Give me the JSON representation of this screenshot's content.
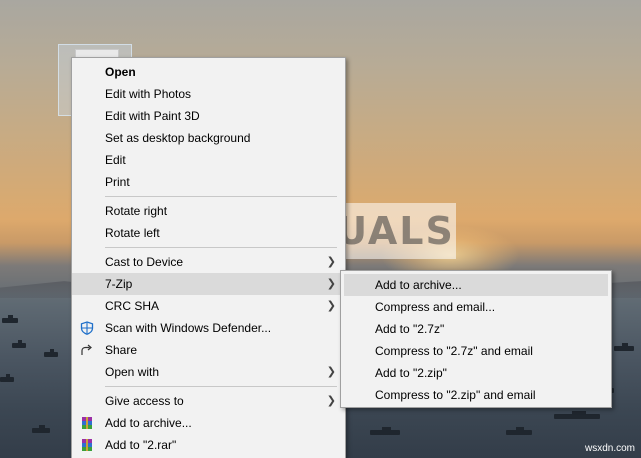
{
  "desktop": {
    "watermark": "APPUALS",
    "site": "wsxdn.com"
  },
  "context_menu": {
    "items": [
      {
        "label": "Open",
        "bold": true
      },
      {
        "label": "Edit with Photos"
      },
      {
        "label": "Edit with Paint 3D"
      },
      {
        "label": "Set as desktop background"
      },
      {
        "label": "Edit"
      },
      {
        "label": "Print"
      },
      {
        "label": "Rotate right"
      },
      {
        "label": "Rotate left"
      },
      {
        "label": "Cast to Device",
        "submenu": true
      },
      {
        "label": "7-Zip",
        "submenu": true,
        "highlighted": true
      },
      {
        "label": "CRC SHA",
        "submenu": true
      },
      {
        "label": "Scan with Windows Defender...",
        "icon": "windows-defender-icon"
      },
      {
        "label": "Share",
        "icon": "share-icon"
      },
      {
        "label": "Open with",
        "submenu": true
      },
      {
        "label": "Give access to",
        "submenu": true
      },
      {
        "label": "Add to archive...",
        "icon": "winrar-icon"
      },
      {
        "label": "Add to \"2.rar\"",
        "icon": "winrar-icon"
      }
    ]
  },
  "submenu_7zip": {
    "items": [
      {
        "label": "Add to archive...",
        "highlighted": true
      },
      {
        "label": "Compress and email..."
      },
      {
        "label": "Add to \"2.7z\""
      },
      {
        "label": "Compress to \"2.7z\" and email"
      },
      {
        "label": "Add to \"2.zip\""
      },
      {
        "label": "Compress to \"2.zip\" and email"
      }
    ]
  },
  "colors": {
    "menu_bg": "#f2f2f2",
    "highlight": "#dadada",
    "defender_blue": "#1e6fc9"
  }
}
